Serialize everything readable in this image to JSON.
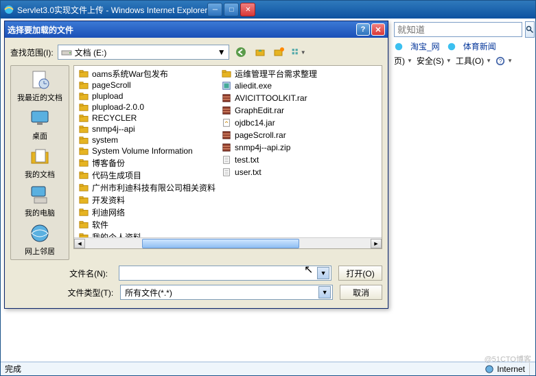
{
  "ie": {
    "title": "Servlet3.0实现文件上传 - Windows Internet Explorer",
    "search_placeholder": "就知道",
    "favorites": {
      "link1": "淘宝_网",
      "link2": "体育新闻"
    },
    "cmdbar": {
      "page": "页)",
      "safe": "安全(S)",
      "tools": "工具(O)"
    },
    "status": {
      "done": "完成",
      "zone": "Internet"
    }
  },
  "dialog": {
    "title": "选择要加载的文件",
    "lookin_label": "查找范围(I):",
    "lookin_value": "文档 (E:)",
    "places": {
      "recent": "我最近的文档",
      "desktop": "桌面",
      "mydocs": "我的文档",
      "mycomputer": "我的电脑",
      "network": "网上邻居"
    },
    "files_col1": [
      {
        "name": "oams系统War包发布",
        "type": "folder"
      },
      {
        "name": "pageScroll",
        "type": "folder"
      },
      {
        "name": "plupload",
        "type": "folder"
      },
      {
        "name": "plupload-2.0.0",
        "type": "folder"
      },
      {
        "name": "RECYCLER",
        "type": "folder"
      },
      {
        "name": "snmp4j--api",
        "type": "folder"
      },
      {
        "name": "system",
        "type": "folder"
      },
      {
        "name": "System Volume Information",
        "type": "folder"
      },
      {
        "name": "博客备份",
        "type": "folder"
      },
      {
        "name": "代码生成项目",
        "type": "folder"
      },
      {
        "name": "广州市利迪科技有限公司相关资料",
        "type": "folder"
      },
      {
        "name": "开发资料",
        "type": "folder"
      },
      {
        "name": "利迪网络",
        "type": "folder"
      },
      {
        "name": "软件",
        "type": "folder"
      },
      {
        "name": "我的个人资料",
        "type": "folder"
      }
    ],
    "files_col2": [
      {
        "name": "运维管理平台需求整理",
        "type": "folder"
      },
      {
        "name": "aliedit.exe",
        "type": "exe"
      },
      {
        "name": "AVICITTOOLKIT.rar",
        "type": "rar"
      },
      {
        "name": "GraphEdit.rar",
        "type": "rar"
      },
      {
        "name": "ojdbc14.jar",
        "type": "jar"
      },
      {
        "name": "pageScroll.rar",
        "type": "rar"
      },
      {
        "name": "snmp4j--api.zip",
        "type": "zip"
      },
      {
        "name": "test.txt",
        "type": "txt"
      },
      {
        "name": "user.txt",
        "type": "txt"
      }
    ],
    "filename_label": "文件名(N):",
    "filetype_label": "文件类型(T):",
    "filetype_value": "所有文件(*.*)",
    "open_btn": "打开(O)",
    "cancel_btn": "取消"
  },
  "watermark": "@51CTO博客"
}
